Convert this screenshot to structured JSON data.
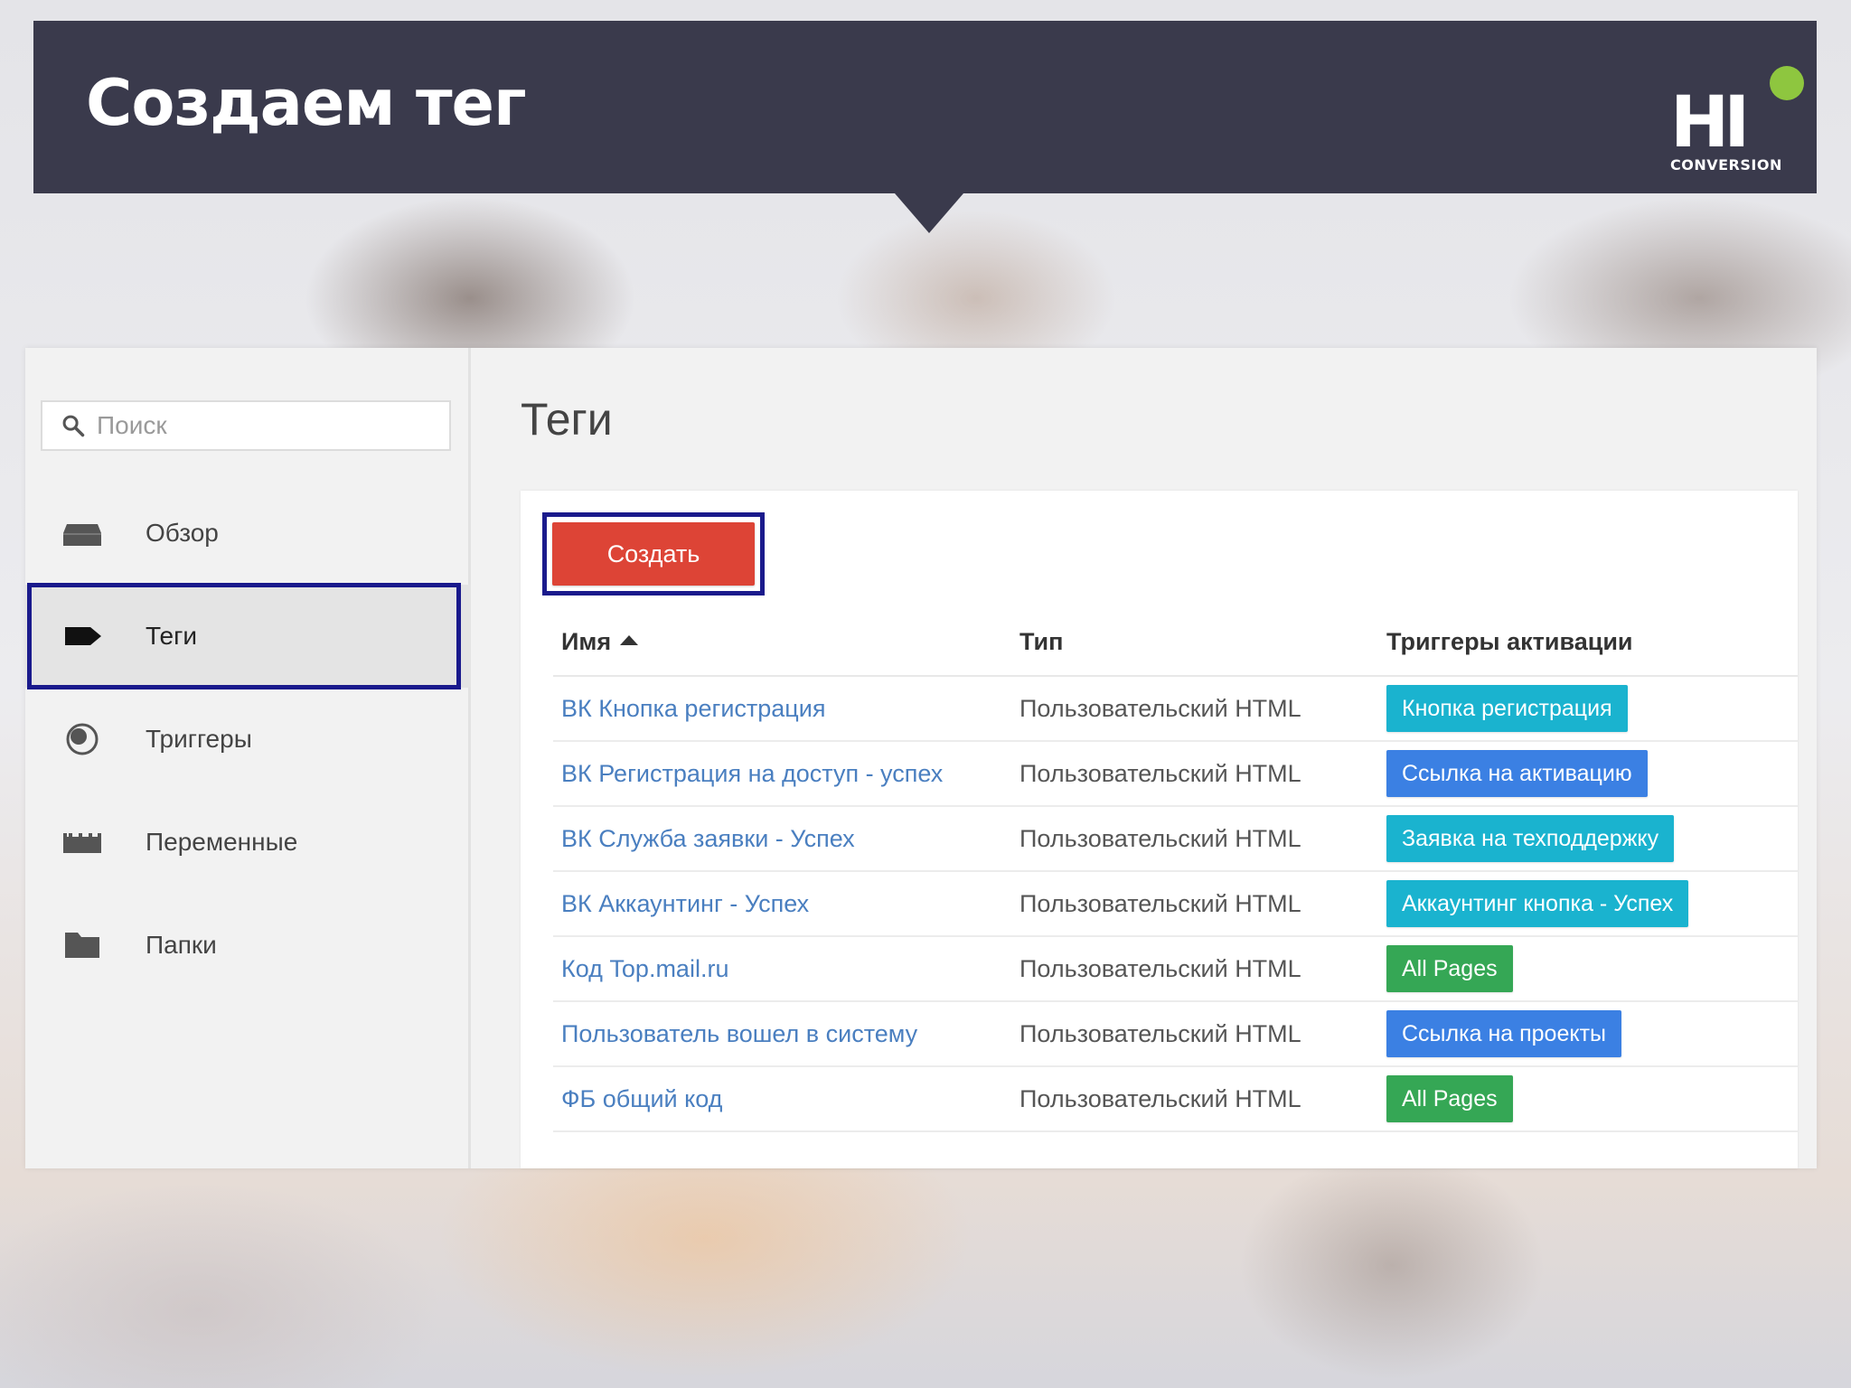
{
  "slide": {
    "title": "Создаем тег",
    "logo": {
      "main": "HI",
      "sub": "CONVERSION",
      "dot_color": "#8ec63f"
    }
  },
  "sidebar": {
    "search_placeholder": "Поиск",
    "items": [
      {
        "label": "Обзор",
        "icon": "overview-icon",
        "active": false
      },
      {
        "label": "Теги",
        "icon": "tag-icon",
        "active": true
      },
      {
        "label": "Триггеры",
        "icon": "trigger-icon",
        "active": false
      },
      {
        "label": "Переменные",
        "icon": "variables-icon",
        "active": false
      },
      {
        "label": "Папки",
        "icon": "folder-icon",
        "active": false
      }
    ]
  },
  "main": {
    "page_title": "Теги",
    "create_label": "Создать",
    "columns": {
      "name": "Имя",
      "type": "Тип",
      "triggers": "Триггеры активации"
    },
    "rows": [
      {
        "name": "ВК Кнопка регистрация",
        "type": "Пользовательский HTML",
        "trigger": "Кнопка регистрация",
        "trigger_color": "#1ab3cf"
      },
      {
        "name": "ВК Регистрация на доступ - успех",
        "type": "Пользовательский HTML",
        "trigger": "Ссылка на активацию",
        "trigger_color": "#3b80e3"
      },
      {
        "name": "ВК Служба заявки - Успех",
        "type": "Пользовательский HTML",
        "trigger": "Заявка на техподдержку",
        "trigger_color": "#1ab3cf"
      },
      {
        "name": "ВК Аккаунтинг - Успех",
        "type": "Пользовательский HTML",
        "trigger": "Аккаунтинг кнопка - Успех",
        "trigger_color": "#1ab3cf"
      },
      {
        "name": "Код Top.mail.ru",
        "type": "Пользовательский HTML",
        "trigger": "All Pages",
        "trigger_color": "#35a755"
      },
      {
        "name": "Пользователь вошел в систему",
        "type": "Пользовательский HTML",
        "trigger": "Ссылка на проекты",
        "trigger_color": "#3b80e3"
      },
      {
        "name": "ФБ общий код",
        "type": "Пользовательский HTML",
        "trigger": "All Pages",
        "trigger_color": "#35a755"
      }
    ]
  },
  "colors": {
    "banner": "#3a3a4c",
    "highlight": "#1a1a8c",
    "create_button": "#dd4436",
    "link": "#4a7fc0"
  }
}
